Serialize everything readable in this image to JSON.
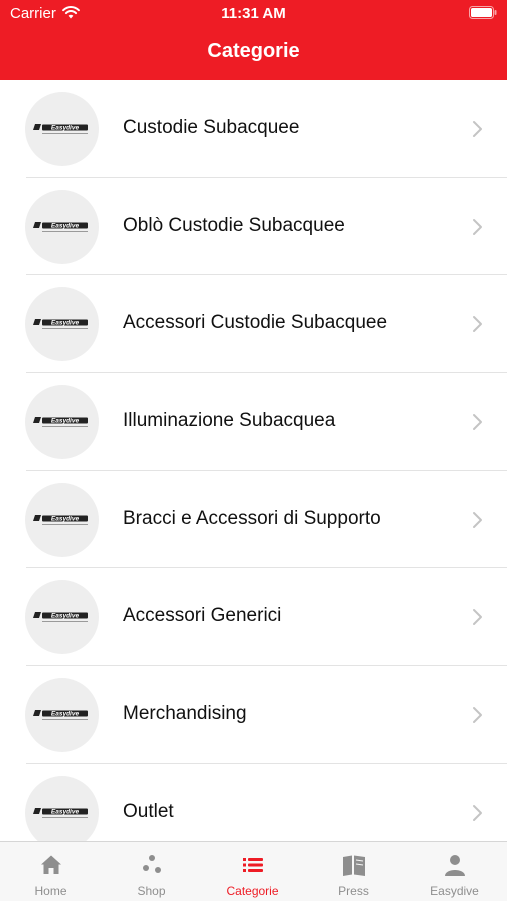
{
  "status_bar": {
    "carrier": "Carrier",
    "time": "11:31 AM"
  },
  "nav": {
    "title": "Categorie"
  },
  "brand": {
    "logo_text": "Easydive"
  },
  "categories": [
    {
      "label": "Custodie Subacquee"
    },
    {
      "label": "Oblò Custodie Subacquee"
    },
    {
      "label": "Accessori Custodie Subacquee"
    },
    {
      "label": "Illuminazione Subacquea"
    },
    {
      "label": "Bracci e Accessori di Supporto"
    },
    {
      "label": "Accessori Generici"
    },
    {
      "label": "Merchandising"
    },
    {
      "label": "Outlet"
    }
  ],
  "tabbar": {
    "items": [
      {
        "label": "Home",
        "icon": "home-icon"
      },
      {
        "label": "Shop",
        "icon": "shop-icon"
      },
      {
        "label": "Categorie",
        "icon": "list-icon",
        "active": true
      },
      {
        "label": "Press",
        "icon": "book-icon"
      },
      {
        "label": "Easydive",
        "icon": "person-icon"
      }
    ]
  },
  "colors": {
    "accent": "#ee1c25",
    "inactive": "#8e8e8e",
    "separator": "#e3e3e3"
  }
}
